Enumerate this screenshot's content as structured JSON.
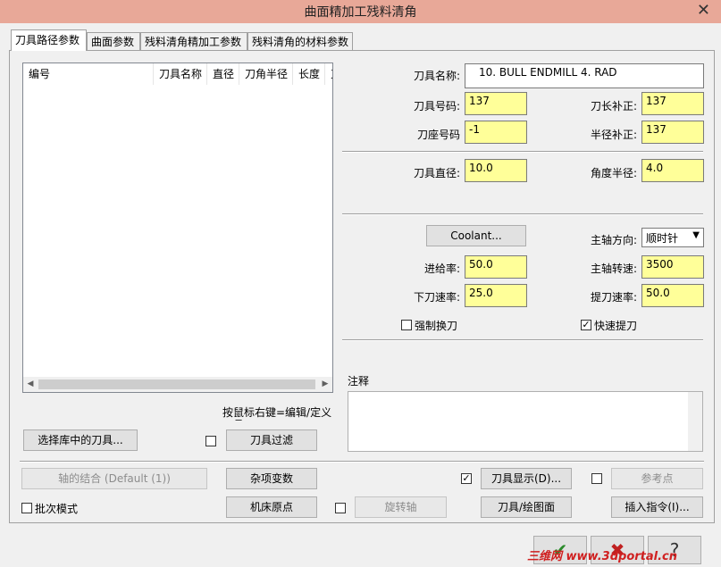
{
  "window": {
    "title": "曲面精加工残料清角",
    "close_glyph": "✕"
  },
  "tabs": [
    {
      "label": "刀具路径参数",
      "active": true
    },
    {
      "label": "曲面参数"
    },
    {
      "label": "残料清角精加工参数"
    },
    {
      "label": "残料清角的材料参数"
    }
  ],
  "tool_list": {
    "columns": [
      "编号",
      "刀具名称",
      "直径",
      "刀角半径",
      "长度",
      "刀"
    ],
    "rows": []
  },
  "right_click_hint": "按鼠标右键=编辑/定义刀具",
  "buttons": {
    "select_from_library": "选择库中的刀具...",
    "tool_filter": "刀具过滤",
    "axis_combo": "轴的结合 (Default (1))",
    "misc_values": "杂项变数",
    "machine_origin": "机床原点",
    "rotary_axis": "旋转轴",
    "tool_display": "刀具显示(D)...",
    "tool_plane": "刀具/绘图面",
    "ref_point": "参考点",
    "insert_cmd": "插入指令(I)...",
    "coolant": "Coolant..."
  },
  "tool": {
    "name_label": "刀具名称:",
    "name_value": "10. BULL ENDMILL 4. RAD",
    "tool_no_label": "刀具号码:",
    "tool_no_value": "137",
    "length_offset_label": "刀长补正:",
    "length_offset_value": "137",
    "holder_no_label": "刀座号码",
    "holder_no_value": "-1",
    "dia_offset_label": "半径补正:",
    "dia_offset_value": "137",
    "diameter_label": "刀具直径:",
    "diameter_value": "10.0",
    "corner_radius_label": "角度半径:",
    "corner_radius_value": "4.0",
    "spindle_dir_label": "主轴方向:",
    "spindle_dir_value": "顺时针",
    "feed_label": "进给率:",
    "feed_value": "50.0",
    "spindle_speed_label": "主轴转速:",
    "spindle_speed_value": "3500",
    "plunge_label": "下刀速率:",
    "plunge_value": "25.0",
    "retract_label": "提刀速率:",
    "retract_value": "50.0"
  },
  "checkboxes": {
    "force_tool_change": {
      "label": "强制换刀",
      "checked": false
    },
    "rapid_retract": {
      "label": "快速提刀",
      "checked": true
    },
    "batch_mode": {
      "label": "批次模式",
      "checked": false
    },
    "tool_filter_chk": {
      "checked": false
    },
    "rotary_axis_chk": {
      "checked": false
    },
    "tool_display_chk": {
      "checked": true
    },
    "ref_point_chk": {
      "checked": false
    }
  },
  "notes": {
    "label": "注释",
    "value": ""
  },
  "footer": {
    "ok_glyph": "✔",
    "cancel_glyph": "✖",
    "help_glyph": "?"
  },
  "watermark": "三维网 www.3dportal.cn",
  "colors": {
    "titlebar": "#e8a898",
    "field_yellow": "#ffff99"
  }
}
